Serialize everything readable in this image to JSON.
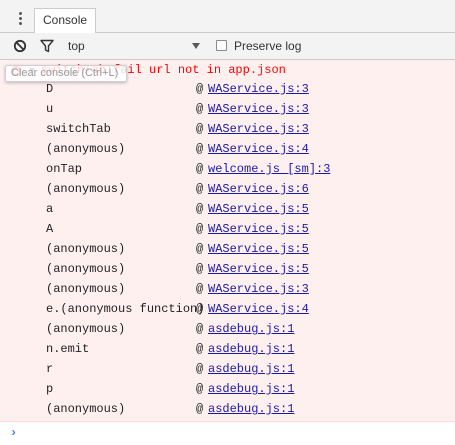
{
  "tabbar": {
    "tab_label": "Console"
  },
  "toolbar": {
    "context": "top",
    "preserve_log_label": "Preserve log",
    "clear_tooltip": "Clear console (Ctrl+L)"
  },
  "error": {
    "message": "switchTab:fail url not in app.json"
  },
  "stack_trace": [
    {
      "fn": "D",
      "loc": "WAService.js:3"
    },
    {
      "fn": "u",
      "loc": "WAService.js:3"
    },
    {
      "fn": "switchTab",
      "loc": "WAService.js:3"
    },
    {
      "fn": "(anonymous)",
      "loc": "WAService.js:4"
    },
    {
      "fn": "onTap",
      "loc": "welcome.js [sm]:3"
    },
    {
      "fn": "(anonymous)",
      "loc": "WAService.js:6"
    },
    {
      "fn": "a",
      "loc": "WAService.js:5"
    },
    {
      "fn": "A",
      "loc": "WAService.js:5"
    },
    {
      "fn": "(anonymous)",
      "loc": "WAService.js:5"
    },
    {
      "fn": "(anonymous)",
      "loc": "WAService.js:5"
    },
    {
      "fn": "(anonymous)",
      "loc": "WAService.js:3"
    },
    {
      "fn": "e.(anonymous function)",
      "loc": "WAService.js:4"
    },
    {
      "fn": "(anonymous)",
      "loc": "asdebug.js:1"
    },
    {
      "fn": "n.emit",
      "loc": "asdebug.js:1"
    },
    {
      "fn": "r",
      "loc": "asdebug.js:1"
    },
    {
      "fn": "p",
      "loc": "asdebug.js:1"
    },
    {
      "fn": "(anonymous)",
      "loc": "asdebug.js:1"
    }
  ],
  "at_symbol": "@",
  "prompt_symbol": "›",
  "colors": {
    "error_text": "#ff0000",
    "error_bg": "#fff0f0",
    "link": "#1a1aa6",
    "prompt": "#367cf1"
  },
  "icons": [
    "kebab-menu-icon",
    "clear-console-icon",
    "filter-icon",
    "dropdown-arrow-icon",
    "error-icon",
    "expand-triangle-icon"
  ]
}
